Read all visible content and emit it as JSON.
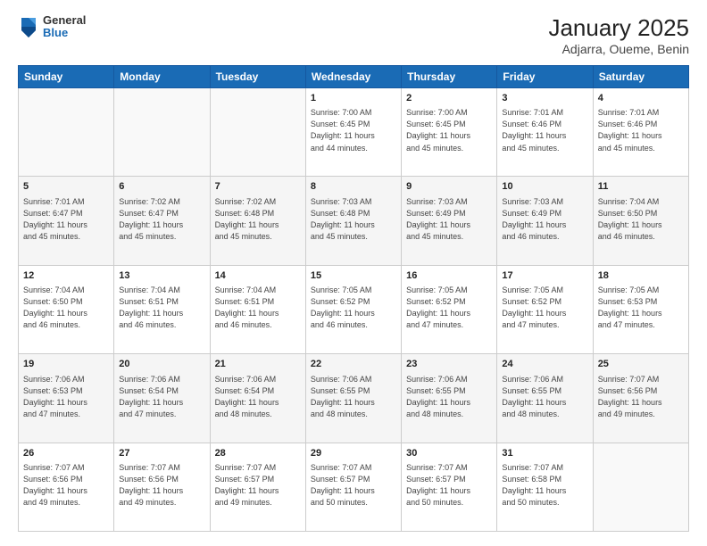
{
  "logo": {
    "general": "General",
    "blue": "Blue"
  },
  "title": "January 2025",
  "subtitle": "Adjarra, Oueme, Benin",
  "weekdays": [
    "Sunday",
    "Monday",
    "Tuesday",
    "Wednesday",
    "Thursday",
    "Friday",
    "Saturday"
  ],
  "weeks": [
    [
      {
        "date": "",
        "info": ""
      },
      {
        "date": "",
        "info": ""
      },
      {
        "date": "",
        "info": ""
      },
      {
        "date": "1",
        "info": "Sunrise: 7:00 AM\nSunset: 6:45 PM\nDaylight: 11 hours\nand 44 minutes."
      },
      {
        "date": "2",
        "info": "Sunrise: 7:00 AM\nSunset: 6:45 PM\nDaylight: 11 hours\nand 45 minutes."
      },
      {
        "date": "3",
        "info": "Sunrise: 7:01 AM\nSunset: 6:46 PM\nDaylight: 11 hours\nand 45 minutes."
      },
      {
        "date": "4",
        "info": "Sunrise: 7:01 AM\nSunset: 6:46 PM\nDaylight: 11 hours\nand 45 minutes."
      }
    ],
    [
      {
        "date": "5",
        "info": "Sunrise: 7:01 AM\nSunset: 6:47 PM\nDaylight: 11 hours\nand 45 minutes."
      },
      {
        "date": "6",
        "info": "Sunrise: 7:02 AM\nSunset: 6:47 PM\nDaylight: 11 hours\nand 45 minutes."
      },
      {
        "date": "7",
        "info": "Sunrise: 7:02 AM\nSunset: 6:48 PM\nDaylight: 11 hours\nand 45 minutes."
      },
      {
        "date": "8",
        "info": "Sunrise: 7:03 AM\nSunset: 6:48 PM\nDaylight: 11 hours\nand 45 minutes."
      },
      {
        "date": "9",
        "info": "Sunrise: 7:03 AM\nSunset: 6:49 PM\nDaylight: 11 hours\nand 45 minutes."
      },
      {
        "date": "10",
        "info": "Sunrise: 7:03 AM\nSunset: 6:49 PM\nDaylight: 11 hours\nand 46 minutes."
      },
      {
        "date": "11",
        "info": "Sunrise: 7:04 AM\nSunset: 6:50 PM\nDaylight: 11 hours\nand 46 minutes."
      }
    ],
    [
      {
        "date": "12",
        "info": "Sunrise: 7:04 AM\nSunset: 6:50 PM\nDaylight: 11 hours\nand 46 minutes."
      },
      {
        "date": "13",
        "info": "Sunrise: 7:04 AM\nSunset: 6:51 PM\nDaylight: 11 hours\nand 46 minutes."
      },
      {
        "date": "14",
        "info": "Sunrise: 7:04 AM\nSunset: 6:51 PM\nDaylight: 11 hours\nand 46 minutes."
      },
      {
        "date": "15",
        "info": "Sunrise: 7:05 AM\nSunset: 6:52 PM\nDaylight: 11 hours\nand 46 minutes."
      },
      {
        "date": "16",
        "info": "Sunrise: 7:05 AM\nSunset: 6:52 PM\nDaylight: 11 hours\nand 47 minutes."
      },
      {
        "date": "17",
        "info": "Sunrise: 7:05 AM\nSunset: 6:52 PM\nDaylight: 11 hours\nand 47 minutes."
      },
      {
        "date": "18",
        "info": "Sunrise: 7:05 AM\nSunset: 6:53 PM\nDaylight: 11 hours\nand 47 minutes."
      }
    ],
    [
      {
        "date": "19",
        "info": "Sunrise: 7:06 AM\nSunset: 6:53 PM\nDaylight: 11 hours\nand 47 minutes."
      },
      {
        "date": "20",
        "info": "Sunrise: 7:06 AM\nSunset: 6:54 PM\nDaylight: 11 hours\nand 47 minutes."
      },
      {
        "date": "21",
        "info": "Sunrise: 7:06 AM\nSunset: 6:54 PM\nDaylight: 11 hours\nand 48 minutes."
      },
      {
        "date": "22",
        "info": "Sunrise: 7:06 AM\nSunset: 6:55 PM\nDaylight: 11 hours\nand 48 minutes."
      },
      {
        "date": "23",
        "info": "Sunrise: 7:06 AM\nSunset: 6:55 PM\nDaylight: 11 hours\nand 48 minutes."
      },
      {
        "date": "24",
        "info": "Sunrise: 7:06 AM\nSunset: 6:55 PM\nDaylight: 11 hours\nand 48 minutes."
      },
      {
        "date": "25",
        "info": "Sunrise: 7:07 AM\nSunset: 6:56 PM\nDaylight: 11 hours\nand 49 minutes."
      }
    ],
    [
      {
        "date": "26",
        "info": "Sunrise: 7:07 AM\nSunset: 6:56 PM\nDaylight: 11 hours\nand 49 minutes."
      },
      {
        "date": "27",
        "info": "Sunrise: 7:07 AM\nSunset: 6:56 PM\nDaylight: 11 hours\nand 49 minutes."
      },
      {
        "date": "28",
        "info": "Sunrise: 7:07 AM\nSunset: 6:57 PM\nDaylight: 11 hours\nand 49 minutes."
      },
      {
        "date": "29",
        "info": "Sunrise: 7:07 AM\nSunset: 6:57 PM\nDaylight: 11 hours\nand 50 minutes."
      },
      {
        "date": "30",
        "info": "Sunrise: 7:07 AM\nSunset: 6:57 PM\nDaylight: 11 hours\nand 50 minutes."
      },
      {
        "date": "31",
        "info": "Sunrise: 7:07 AM\nSunset: 6:58 PM\nDaylight: 11 hours\nand 50 minutes."
      },
      {
        "date": "",
        "info": ""
      }
    ]
  ]
}
